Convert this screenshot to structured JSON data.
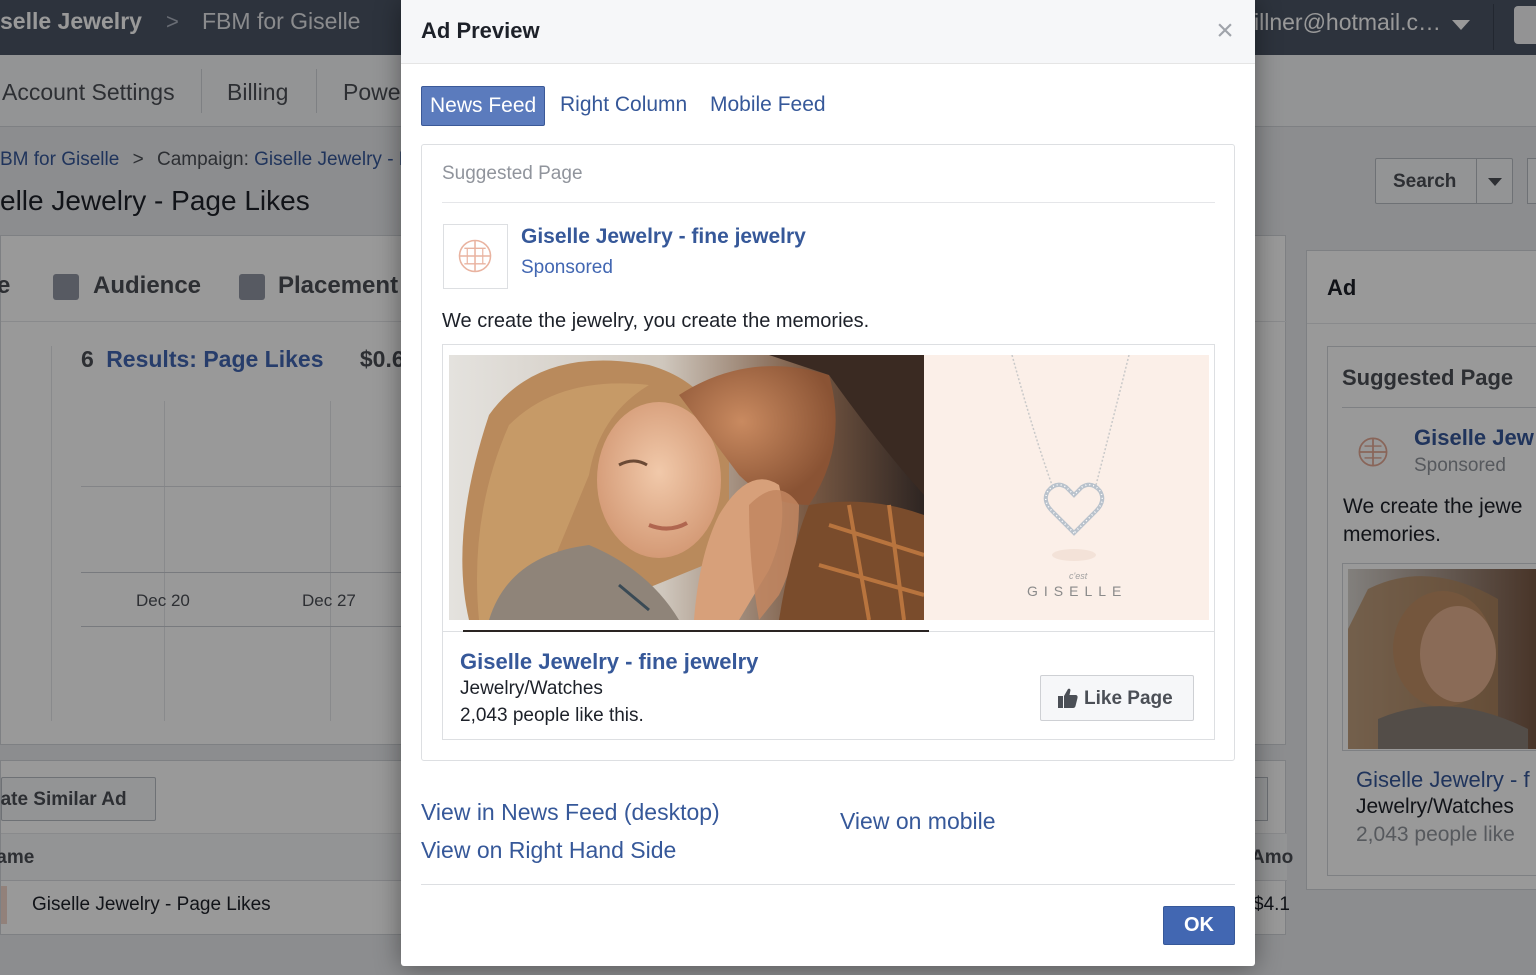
{
  "background": {
    "topbar": {
      "crumb_account": "selle Jewelry",
      "crumb_sep": ">",
      "crumb_fbm": "FBM for Giselle",
      "email": "illner@hotmail.c…"
    },
    "subnav": {
      "items": [
        "Account Settings",
        "Billing",
        "Powe"
      ]
    },
    "breadcrumb": {
      "fbm": "BM for Giselle",
      "sep": ">",
      "campaign_label": "Campaign:",
      "campaign_name": "Giselle Jewelry - P"
    },
    "page_title": "elle Jewelry - Page Likes",
    "search_label": "Search",
    "tabs": [
      "e",
      "Audience",
      "Placement"
    ],
    "results": {
      "count": "6",
      "label": "Results: Page Likes",
      "cost": "$0.6"
    },
    "chart_dates": [
      "Dec 20",
      "Dec 27"
    ],
    "ad_panel": {
      "header": "Ad",
      "suggested": "Suggested Page",
      "page_name": "Giselle Jew",
      "sponsored": "Sponsored",
      "text": "We create the jewe memories.",
      "page_name_2": "Giselle Jewelry - f",
      "category": "Jewelry/Watches",
      "likes": "2,043 people like"
    },
    "create_similar": "eate Similar Ad",
    "table": {
      "col_name": "lame",
      "col_amount": "Amo",
      "row_name": "Giselle Jewelry - Page Likes",
      "row_amount": "$4.1"
    }
  },
  "dialog": {
    "title": "Ad Preview",
    "close_glyph": "×",
    "tabs": [
      {
        "label": "News Feed",
        "active": true
      },
      {
        "label": "Right Column",
        "active": false
      },
      {
        "label": "Mobile Feed",
        "active": false
      }
    ],
    "preview": {
      "suggested_label": "Suggested Page",
      "page_name": "Giselle Jewelry - fine jewelry",
      "sponsored": "Sponsored",
      "ad_text": "We create the jewelry, you create the memories.",
      "image_brand": "GISELLE",
      "image_brand_small": "c'est",
      "card_page_name": "Giselle Jewelry - fine jewelry",
      "category": "Jewelry/Watches",
      "likes": "2,043 people like this.",
      "like_button": "Like Page"
    },
    "links": {
      "news_feed_desktop": "View in News Feed (desktop)",
      "right_hand_side": "View on Right Hand Side",
      "mobile": "View on mobile"
    },
    "ok_label": "OK"
  },
  "colors": {
    "topbar": "#4b5566",
    "link": "#365899",
    "primary_button": "#4267b2",
    "active_tab": "#5b7bbd",
    "necklace_bg": "#fbefe8"
  }
}
